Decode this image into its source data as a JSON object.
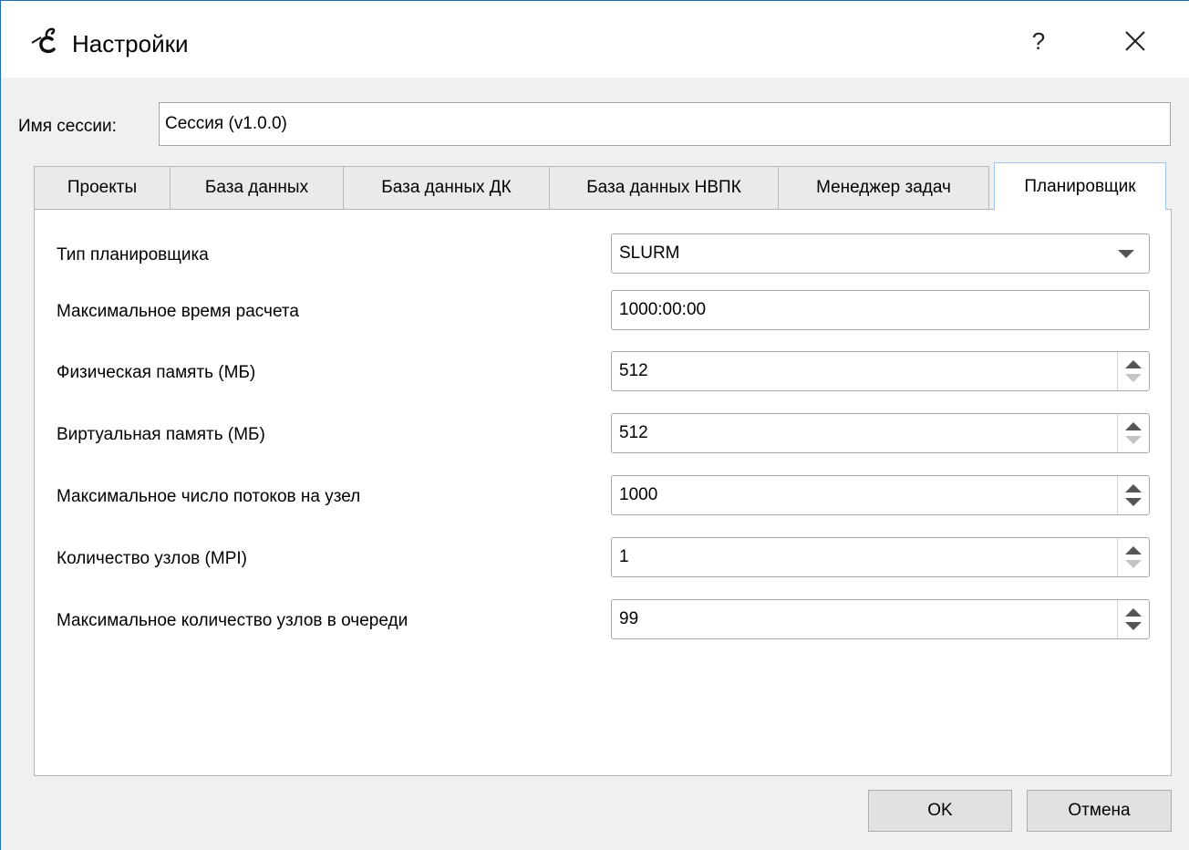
{
  "window": {
    "title": "Настройки",
    "help_label": "?",
    "icons": {
      "app": "app-logo-icon",
      "close": "close-icon"
    }
  },
  "session": {
    "label": "Имя сессии:",
    "value": "Сессия (v1.0.0)"
  },
  "tabs": [
    {
      "label": "Проекты",
      "active": false
    },
    {
      "label": "База данных",
      "active": false
    },
    {
      "label": "База данных ДК",
      "active": false
    },
    {
      "label": "База данных НВПК",
      "active": false
    },
    {
      "label": "Менеджер задач",
      "active": false
    },
    {
      "label": "Планировщик",
      "active": true
    }
  ],
  "scheduler": {
    "type_label": "Тип планировщика",
    "type_value": "SLURM",
    "max_time_label": "Максимальное время расчета",
    "max_time_value": "1000:00:00",
    "phys_mem_label": "Физическая память (МБ)",
    "phys_mem_value": "512",
    "virt_mem_label": "Виртуальная память (МБ)",
    "virt_mem_value": "512",
    "threads_label": "Максимальное число потоков на узел",
    "threads_value": "1000",
    "nodes_label": "Количество узлов (MPI)",
    "nodes_value": "1",
    "max_nodes_label": "Максимальное количество узлов в очереди",
    "max_nodes_value": "99"
  },
  "buttons": {
    "ok": "OK",
    "cancel": "Отмена"
  }
}
